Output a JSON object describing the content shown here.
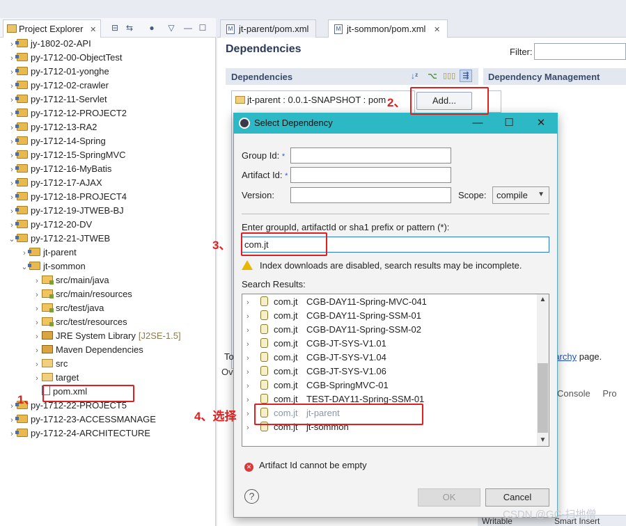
{
  "project_explorer": {
    "tab_label": "Project Explorer",
    "tab_close": "✕",
    "items": [
      {
        "label": "jy-1802-02-API"
      },
      {
        "label": "py-1712-00-ObjectTest"
      },
      {
        "label": "py-1712-01-yonghe"
      },
      {
        "label": "py-1712-02-crawler"
      },
      {
        "label": "py-1712-11-Servlet"
      },
      {
        "label": "py-1712-12-PROJECT2"
      },
      {
        "label": "py-1712-13-RA2"
      },
      {
        "label": "py-1712-14-Spring"
      },
      {
        "label": "py-1712-15-SpringMVC"
      },
      {
        "label": "py-1712-16-MyBatis"
      },
      {
        "label": "py-1712-17-AJAX"
      },
      {
        "label": "py-1712-18-PROJECT4"
      },
      {
        "label": "py-1712-19-JTWEB-BJ"
      },
      {
        "label": "py-1712-20-DV"
      },
      {
        "label": "py-1712-21-JTWEB"
      },
      {
        "label": "jt-parent"
      },
      {
        "label": "jt-sommon"
      },
      {
        "label": "src/main/java"
      },
      {
        "label": "src/main/resources"
      },
      {
        "label": "src/test/java"
      },
      {
        "label": "src/test/resources"
      },
      {
        "label": "JRE System Library",
        "suffix": "[J2SE-1.5]"
      },
      {
        "label": "Maven Dependencies"
      },
      {
        "label": "src"
      },
      {
        "label": "target"
      },
      {
        "label": "pom.xml"
      },
      {
        "label": "py-1712-22-PROJECT5"
      },
      {
        "label": "py-1712-23-ACCESSMANAGE"
      },
      {
        "label": "py-1712-24-ARCHITECTURE"
      }
    ]
  },
  "editor": {
    "tabs": [
      {
        "label": "jt-parent/pom.xml"
      },
      {
        "label": "jt-sommon/pom.xml",
        "close": "✕"
      }
    ],
    "title": "Dependencies",
    "filter_label": "Filter:",
    "dependencies_section": "Dependencies",
    "dependency_management_section": "Dependency Management",
    "dependency_item": "jt-parent : 0.0.1-SNAPSHOT : pom",
    "add_button": "Add...",
    "footer_text_prefix": "To",
    "overview_tab": "Ov",
    "hierarchy_link": "rarchy",
    "hierarchy_suffix": " page.",
    "console_label": "Console",
    "pro_label": "Pro",
    "status_writable": "Writable",
    "status_insert": "Smart Insert"
  },
  "dialog": {
    "title": "Select Dependency",
    "group_id_label": "Group Id:",
    "artifact_id_label": "Artifact Id:",
    "version_label": "Version:",
    "required_mark": "*",
    "scope_label": "Scope:",
    "scope_value": "compile",
    "query_label": "Enter groupId, artifactId or sha1 prefix or pattern (*):",
    "query_value": "com.jt",
    "warning": "Index downloads are disabled, search results may be incomplete.",
    "results_label": "Search Results:",
    "results": [
      {
        "group": "com.jt",
        "artifact": "CGB-DAY11-Spring-MVC-041"
      },
      {
        "group": "com.jt",
        "artifact": "CGB-DAY11-Spring-SSM-01"
      },
      {
        "group": "com.jt",
        "artifact": "CGB-DAY11-Spring-SSM-02"
      },
      {
        "group": "com.jt",
        "artifact": "CGB-JT-SYS-V1.01"
      },
      {
        "group": "com.jt",
        "artifact": "CGB-JT-SYS-V1.04"
      },
      {
        "group": "com.jt",
        "artifact": "CGB-JT-SYS-V1.06"
      },
      {
        "group": "com.jt",
        "artifact": "CGB-SpringMVC-01"
      },
      {
        "group": "com.jt",
        "artifact": "TEST-DAY11-Spring-SSM-01"
      },
      {
        "group": "com.jt",
        "artifact": "jt-parent"
      },
      {
        "group": "com.jt",
        "artifact": "jt-sommon"
      }
    ],
    "error": "Artifact Id cannot be empty",
    "help": "?",
    "ok_button": "OK",
    "cancel_button": "Cancel",
    "minimize": "—",
    "maximize": "☐",
    "close": "✕"
  },
  "annotations": {
    "step1": "1、",
    "step2": "2、",
    "step3": "3、",
    "step4": "4、选择",
    "color": "#e02020"
  },
  "watermark": "CSDN @GC-扫地僧"
}
